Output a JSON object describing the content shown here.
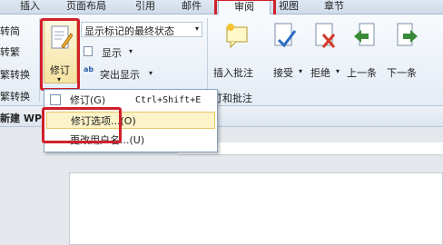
{
  "tabs": [
    {
      "id": "insert",
      "label": "插入"
    },
    {
      "id": "page_layout",
      "label": "页面布局"
    },
    {
      "id": "references",
      "label": "引用"
    },
    {
      "id": "mailings",
      "label": "邮件"
    },
    {
      "id": "review",
      "label": "审阅",
      "active": true
    },
    {
      "id": "view",
      "label": "视图"
    },
    {
      "id": "chapter",
      "label": "章节"
    }
  ],
  "left_group": {
    "items": [
      "转简",
      "转繁",
      "繁转换",
      "繁转换"
    ]
  },
  "track": {
    "revise_label": "修订",
    "display_mode": "显示标记的最终状态",
    "show_label": "显示",
    "highlight_label": "突出显示"
  },
  "comments": {
    "insert_comment": "插入批注",
    "group_label": "订和批注"
  },
  "changes": {
    "accept": "接受",
    "reject": "拒绝",
    "previous": "上一条",
    "next": "下一条"
  },
  "doc_tab": {
    "title": "新建 WP"
  },
  "dropdown": {
    "items": [
      {
        "label": "修订(G)",
        "shortcut": "Ctrl+Shift+E"
      },
      {
        "label": "修订选项...(O)",
        "shortcut": ""
      },
      {
        "label": "更改用户名...(U)",
        "shortcut": ""
      }
    ]
  },
  "colors": {
    "highlight_box": "#d0202a",
    "ribbon_bg": "#e4ecf5",
    "menu_highlight": "#fdf3c8"
  }
}
